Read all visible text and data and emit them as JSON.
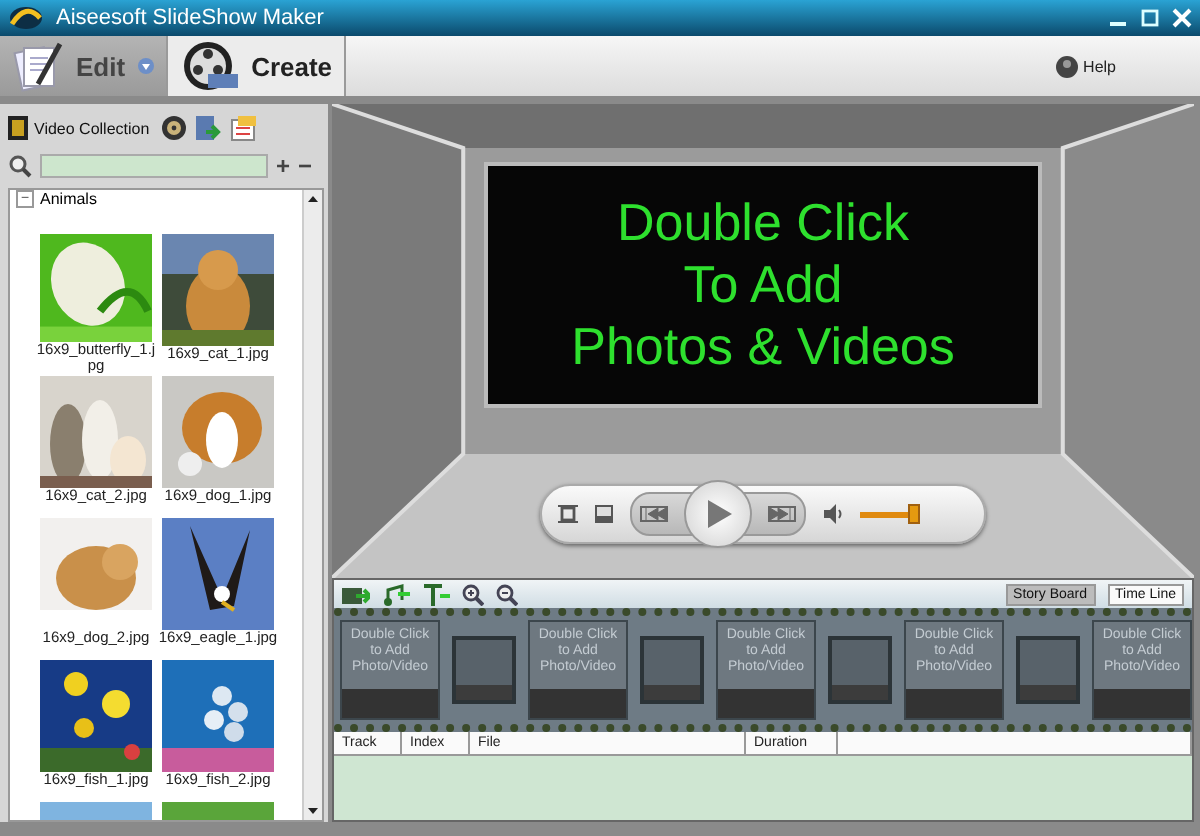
{
  "window": {
    "title": "Aiseesoft SlideShow Maker"
  },
  "toolbar": {
    "tabs": [
      {
        "label": "Edit",
        "selected": true,
        "kind": "edit"
      },
      {
        "label": "Create",
        "selected": false,
        "kind": "create"
      }
    ],
    "help": "Help"
  },
  "library": {
    "collection_button": "Video Collection",
    "add": "+",
    "remove": "−",
    "category": {
      "label": "Animals",
      "toggle": "−",
      "expanded": true
    },
    "thumbnails": [
      {
        "kind": "picture",
        "label": "16x9_butterfly_1.jpg"
      },
      {
        "kind": "picture",
        "label": "16x9_cat_1.jpg"
      },
      {
        "kind": "picture",
        "label": "16x9_cat_2.jpg"
      },
      {
        "kind": "picture",
        "label": "16x9_dog_1.jpg"
      },
      {
        "kind": "picture",
        "label": "16x9_dog_2.jpg"
      },
      {
        "kind": "picture",
        "label": "16x9_eagle_1.jpg"
      },
      {
        "kind": "picture",
        "label": "16x9_fish_1.jpg"
      },
      {
        "kind": "picture",
        "label": "16x9_fish_2.jpg"
      },
      {
        "kind": "picture"
      },
      {
        "kind": "picture"
      }
    ]
  },
  "preview": {
    "prompt": "Double Click\nTo Add\nPhotos & Videos",
    "volume": {
      "level": 0.95
    }
  },
  "timeline": {
    "views": [
      {
        "label": "Story Board",
        "selected": false
      },
      {
        "label": "Time Line",
        "selected": true
      }
    ],
    "storyboard": [
      {
        "kind": "slot",
        "text": "Double Click to Add Photo/Video"
      },
      {
        "kind": "transition"
      },
      {
        "kind": "slot",
        "text": "Double Click to Add Photo/Video"
      },
      {
        "kind": "transition"
      },
      {
        "kind": "slot",
        "text": "Double Click to Add Photo/Video"
      },
      {
        "kind": "transition"
      },
      {
        "kind": "slot",
        "text": "Double Click to Add Photo/Video"
      },
      {
        "kind": "transition"
      },
      {
        "kind": "slot",
        "text": "Double Click to Add Photo/Video"
      }
    ],
    "columns": [
      "Track",
      "Index",
      "File",
      "Duration",
      ""
    ]
  }
}
